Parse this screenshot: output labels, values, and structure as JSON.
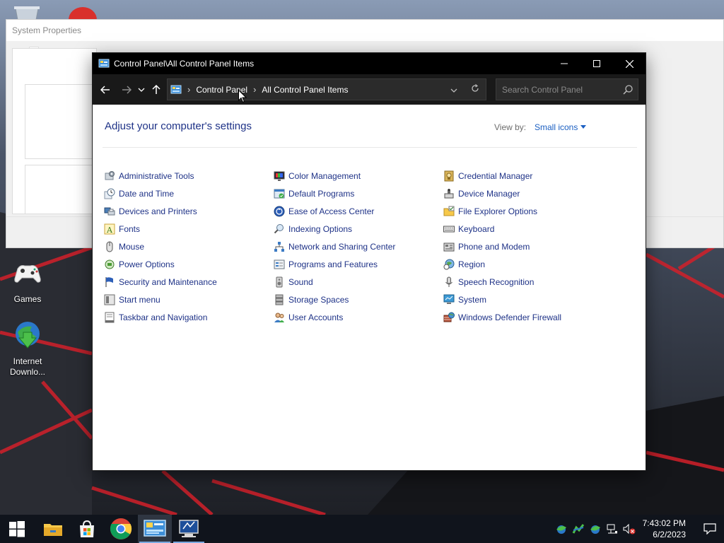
{
  "desktop": {
    "icons": [
      {
        "label": "Games",
        "icon": "xbox-controller-icon"
      },
      {
        "label": "Internet Downlo...",
        "icon": "internet-download-manager-icon"
      }
    ]
  },
  "background_window": {
    "title": "System Properties"
  },
  "window": {
    "title": "Control Panel\\All Control Panel Items",
    "controls": {
      "minimize": "minimize-icon",
      "maximize": "maximize-icon",
      "close": "close-icon"
    }
  },
  "nav": {
    "back": "back-arrow-icon",
    "forward": "forward-arrow-icon",
    "recent": "chevron-down-icon",
    "up": "up-arrow-icon",
    "breadcrumb": [
      "Control Panel",
      "All Control Panel Items"
    ],
    "search_placeholder": "Search Control Panel"
  },
  "content": {
    "heading": "Adjust your computer's settings",
    "view_by_label": "View by:",
    "view_by_value": "Small icons",
    "columns": [
      [
        "Administrative Tools",
        "Date and Time",
        "Devices and Printers",
        "Fonts",
        "Mouse",
        "Power Options",
        "Security and Maintenance",
        "Start menu",
        "Taskbar and Navigation"
      ],
      [
        "Color Management",
        "Default Programs",
        "Ease of Access Center",
        "Indexing Options",
        "Network and Sharing Center",
        "Programs and Features",
        "Sound",
        "Storage Spaces",
        "User Accounts"
      ],
      [
        "Credential Manager",
        "Device Manager",
        "File Explorer Options",
        "Keyboard",
        "Phone and Modem",
        "Region",
        "Speech Recognition",
        "System",
        "Windows Defender Firewall"
      ]
    ]
  },
  "taskbar": {
    "apps": [
      "start-icon",
      "file-explorer-icon",
      "store-icon",
      "chrome-icon",
      "control-panel-icon",
      "system-properties-icon"
    ],
    "active_index": 4,
    "clock_time": "7:43:02 PM",
    "clock_date": "6/2/2023"
  },
  "colors": {
    "link": "#1e3287",
    "accent": "#1b5fc2",
    "titlebar": "#000000"
  }
}
